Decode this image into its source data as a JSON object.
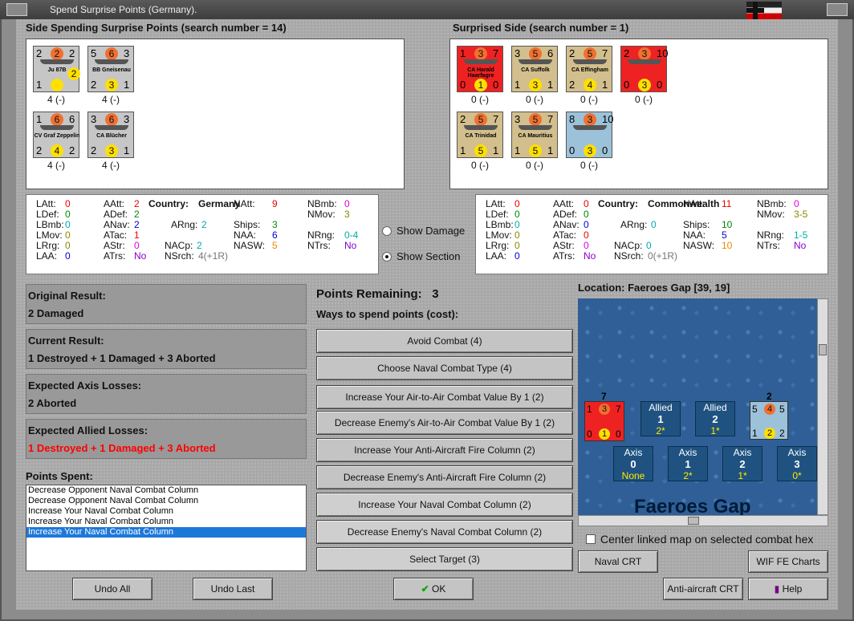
{
  "window": {
    "title": "Spend Surprise Points (Germany)."
  },
  "left_side": {
    "header": "Side Spending Surprise Points (search number = 14)",
    "units": [
      {
        "tl": "2",
        "tc": "2",
        "tr": "2",
        "name": "Ju 87B",
        "bl": "1",
        "bc": "",
        "br": "",
        "mid": "2",
        "below": "4 (-)",
        "style": "grey"
      },
      {
        "tl": "5",
        "tc": "6",
        "tr": "3",
        "name": "BB Gneisenau",
        "bl": "2",
        "bc": "3",
        "br": "1",
        "below": "4 (-)",
        "style": "grey"
      },
      {
        "tl": "1",
        "tc": "6",
        "tr": "6",
        "name": "CV Graf Zeppelin",
        "bl": "2",
        "bc": "4",
        "br": "2",
        "below": "4 (-)",
        "style": "grey"
      },
      {
        "tl": "3",
        "tc": "6",
        "tr": "3",
        "name": "CA Blücher",
        "bl": "2",
        "bc": "3",
        "br": "1",
        "below": "4 (-)",
        "style": "grey"
      }
    ]
  },
  "right_side": {
    "header": "Surprised Side (search number = 1)",
    "units": [
      {
        "tl": "1",
        "tc": "3",
        "tr": "7",
        "name": "CA Harald Haarfagre",
        "bl": "0",
        "bc": "1",
        "br": "0",
        "below": "0 (-)",
        "style": "red"
      },
      {
        "tl": "3",
        "tc": "5",
        "tr": "6",
        "name": "CA Suffolk",
        "bl": "1",
        "bc": "3",
        "br": "1",
        "below": "0 (-)",
        "style": "tan"
      },
      {
        "tl": "2",
        "tc": "5",
        "tr": "7",
        "name": "CA Effingham",
        "bl": "2",
        "bc": "4",
        "br": "1",
        "below": "0 (-)",
        "style": "tan"
      },
      {
        "tl": "2",
        "tc": "3",
        "tr": "10",
        "name": "",
        "bl": "0",
        "bc": "3",
        "br": "0",
        "below": "0 (-)",
        "style": "red"
      },
      {
        "tl": "2",
        "tc": "5",
        "tr": "7",
        "name": "CA Trinidad",
        "bl": "1",
        "bc": "5",
        "br": "1",
        "below": "0 (-)",
        "style": "tan"
      },
      {
        "tl": "3",
        "tc": "5",
        "tr": "7",
        "name": "CA Mauritius",
        "bl": "1",
        "bc": "5",
        "br": "1",
        "below": "0 (-)",
        "style": "tan"
      },
      {
        "tl": "8",
        "tc": "3",
        "tr": "10",
        "name": "",
        "bl": "0",
        "bc": "3",
        "br": "0",
        "below": "0 (-)",
        "style": "blue"
      }
    ]
  },
  "stats_left": {
    "country_label": "Country:",
    "country": "Germany",
    "LAtt": "0",
    "LDef": "0",
    "LBmb": "0",
    "LMov": "0",
    "LRrg": "0",
    "LAA": "0",
    "AAtt": "2",
    "ADef": "2",
    "ANav": "2",
    "ATac": "1",
    "AStr": "0",
    "ATrs": "No",
    "ARng": "2",
    "NACp": "2",
    "NSrch": "4(+1R)",
    "NAtt": "9",
    "Ships": "3",
    "NAA": "6",
    "NASW": "5",
    "NBmb": "0",
    "NMov": "3",
    "NRng": "0-4",
    "NTrs": "No"
  },
  "stats_right": {
    "country_label": "Country:",
    "country": "Commonwealth",
    "LAtt": "0",
    "LDef": "0",
    "LBmb": "0",
    "LMov": "0",
    "LRrg": "0",
    "LAA": "0",
    "AAtt": "0",
    "ADef": "0",
    "ANav": "0",
    "ATac": "0",
    "AStr": "0",
    "ATrs": "No",
    "ARng": "0",
    "NACp": "0",
    "NSrch": "0(+1R)",
    "NAtt": "11",
    "Ships": "10",
    "NAA": "5",
    "NASW": "10",
    "NBmb": "0",
    "NMov": "3-5",
    "NRng": "1-5",
    "NTrs": "No"
  },
  "labels": {
    "LAtt": "LAtt:",
    "LDef": "LDef:",
    "LBmb": "LBmb:",
    "LMov": "LMov:",
    "LRrg": "LRrg:",
    "LAA": "LAA:",
    "AAtt": "AAtt:",
    "ADef": "ADef:",
    "ANav": "ANav:",
    "ATac": "ATac:",
    "AStr": "AStr:",
    "ATrs": "ATrs:",
    "ARng": "ARng:",
    "NACp": "NACp:",
    "NSrch": "NSrch:",
    "NAtt": "NAtt:",
    "Ships": "Ships:",
    "NAA": "NAA:",
    "NASW": "NASW:",
    "NBmb": "NBmb:",
    "NMov": "NMov:",
    "NRng": "NRng:",
    "NTrs": "NTrs:"
  },
  "radios": {
    "show_damage": "Show Damage",
    "show_section": "Show Section",
    "selected": "show_section"
  },
  "results": {
    "original_title": "Original Result:",
    "original_value": "2 Damaged",
    "current_title": "Current Result:",
    "current_value": "1 Destroyed + 1 Damaged + 3 Aborted",
    "axis_title": "Expected Axis Losses:",
    "axis_value": "2 Aborted",
    "allied_title": "Expected Allied Losses:",
    "allied_value": "1 Destroyed + 1 Damaged + 3 Aborted"
  },
  "points_spent": {
    "title": "Points Spent:",
    "items": [
      "Decrease Opponent Naval Combat Column",
      "Decrease Opponent Naval Combat Column",
      "Increase Your Naval Combat Column",
      "Increase Your Naval Combat Column",
      "Increase Your Naval Combat Column"
    ],
    "selected_index": 4
  },
  "spend": {
    "remaining_label": "Points Remaining:",
    "remaining_value": "3",
    "ways_label": "Ways to spend points (cost):",
    "options": [
      "Avoid Combat (4)",
      "Choose Naval Combat Type (4)",
      "Increase Your Air-to-Air Combat Value By 1 (2)",
      "Decrease Enemy's Air-to-Air Combat Value By 1 (2)",
      "Increase Your Anti-Aircraft Fire Column (2)",
      "Decrease Enemy's Anti-Aircraft Fire Column (2)",
      "Increase Your Naval Combat Column (2)",
      "Decrease Enemy's Naval Combat Column (2)",
      "Select Target (3)"
    ]
  },
  "map": {
    "location": "Location: Faeroes Gap [39, 19]",
    "name": "Faeroes Gap",
    "counter": {
      "top": "7",
      "tl": "1",
      "tc": "3",
      "tr": "7",
      "bl": "0",
      "bc": "1",
      "br": "0"
    },
    "counter2": {
      "top": "2",
      "tl": "5",
      "tc": "4",
      "tr": "5",
      "bl": "1",
      "bc": "2",
      "br": "2"
    },
    "allied": [
      {
        "label": "Allied",
        "num": "1",
        "sub": "2*"
      },
      {
        "label": "Allied",
        "num": "2",
        "sub": "1*"
      }
    ],
    "axis": [
      {
        "label": "Axis",
        "num": "0",
        "sub": "None"
      },
      {
        "label": "Axis",
        "num": "1",
        "sub": "2*"
      },
      {
        "label": "Axis",
        "num": "2",
        "sub": "1*"
      },
      {
        "label": "Axis",
        "num": "3",
        "sub": "0*"
      }
    ],
    "center_check": "Center linked map on selected combat hex"
  },
  "buttons": {
    "undo_all": "Undo All",
    "undo_last": "Undo Last",
    "ok": "OK",
    "naval_crt": "Naval CRT",
    "wif_fe_charts": "WIF FE Charts",
    "aa_crt": "Anti-aircraft CRT",
    "help": "Help"
  }
}
